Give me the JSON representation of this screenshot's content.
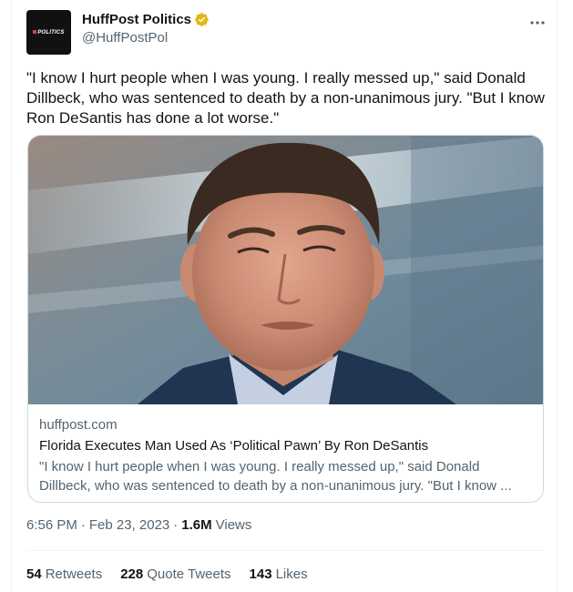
{
  "author": {
    "display_name": "HuffPost Politics",
    "handle": "@HuffPostPol",
    "avatar_text": "POLITICS",
    "verified_color": "#e2b719"
  },
  "tweet": {
    "text": "\"I know I hurt people when I was young. I really messed up,\" said Donald Dillbeck, who was sentenced to death by a non-unanimous jury. \"But I know Ron DeSantis has done a lot worse.\""
  },
  "card": {
    "image_icon": "portrait-photo",
    "domain": "huffpost.com",
    "title": "Florida Executes Man Used As ‘Political Pawn’ By Ron DeSantis",
    "description": "\"I know I hurt people when I was young. I really messed up,\" said Donald Dillbeck, who was sentenced to death by a non-unanimous jury. \"But I know ..."
  },
  "meta": {
    "time": "6:56 PM",
    "separator": "·",
    "date": "Feb 23, 2023",
    "views_count": "1.6M",
    "views_label": "Views"
  },
  "stats": {
    "retweets_count": "54",
    "retweets_label": "Retweets",
    "quotes_count": "228",
    "quotes_label": "Quote Tweets",
    "likes_count": "143",
    "likes_label": "Likes"
  },
  "colors": {
    "accent_gray": "#536471",
    "text": "#0f1419",
    "border": "#cfd9de"
  }
}
